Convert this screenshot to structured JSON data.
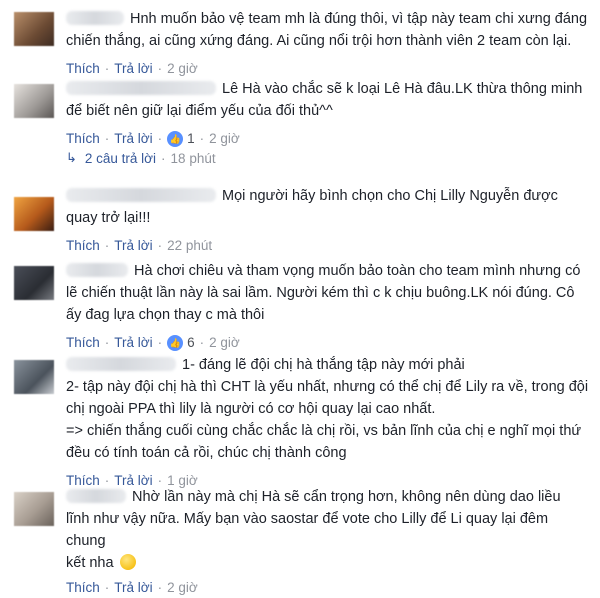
{
  "actions": {
    "like": "Thích",
    "reply": "Trả lời"
  },
  "comments": [
    {
      "lines": [
        "Hnh muốn bảo vệ team mh là đúng thôi, vì tập này team chi xưng đáng",
        "chiến thắng, ai cũng xứng đáng. Ai cũng nổi trội hơn thành viên 2 team còn lại."
      ],
      "time": "2 giờ"
    },
    {
      "lines": [
        "Lê Hà vào chắc sẽ k loại Lê Hà đâu.LK thừa thông minh",
        "để biết nên giữ lại điểm yếu của đối thủ^^"
      ],
      "likes": "1",
      "time": "2 giờ",
      "replies_label": "2 câu trả lời",
      "replies_time": "18 phút"
    },
    {
      "lines": [
        "Mọi người hãy bình chọn cho Chị Lilly Nguyễn được",
        "quay trở lại!!!"
      ],
      "time": "22 phút"
    },
    {
      "lines": [
        "Hà chơi chiêu và tham vọng muốn bảo toàn cho team mình nhưng có",
        "lẽ chiến thuật lần này là sai lầm. Người kém thì c k chịu buông.LK nói đúng. Cô",
        "ấy đag lựa chọn thay c mà thôi"
      ],
      "likes": "6",
      "time": "2 giờ"
    },
    {
      "lines": [
        "1- đáng lẽ đội chị hà thắng tập này mới phải",
        "2- tập này đội chị hà thì CHT là yếu nhất, nhưng có thể chị để Lily ra về, trong đội",
        "chị ngoài PPA thì lily là người có cơ hội quay lại cao nhất.",
        "=> chiến thắng cuối cùng chắc chắc là chị rồi, vs bản lĩnh của chị e nghĩ mọi thứ",
        "đều có tính toán cả rồi, chúc chị thành công"
      ],
      "time": "1 giờ"
    },
    {
      "lines": [
        "Nhờ lần này mà chị Hà sẽ cẩn trọng hơn, không nên dùng dao liều",
        "lĩnh như vậy nữa. Mấy bạn vào saostar để vote cho Lilly để Li quay lại đêm chung",
        "kết nha"
      ],
      "time": "2 giờ"
    }
  ],
  "colors": {
    "link": "#365899",
    "meta": "#90949c",
    "text": "#1d2129",
    "like_badge": "#5890ff"
  }
}
